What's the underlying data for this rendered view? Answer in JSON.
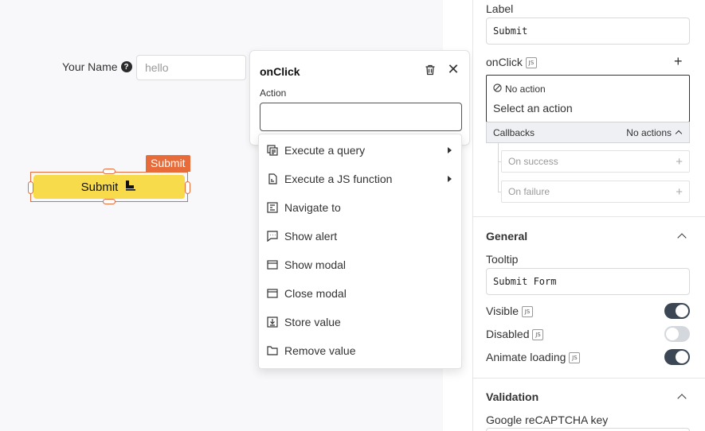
{
  "canvas": {
    "name_label": "Your Name",
    "name_input_value": "hello",
    "submit_tag": "Submit",
    "submit_button": "Submit"
  },
  "popover": {
    "title": "onClick",
    "action_label": "Action",
    "action_value": "",
    "menu": [
      {
        "label": "Execute a query",
        "icon": "query-icon",
        "submenu": true
      },
      {
        "label": "Execute a JS function",
        "icon": "js-function-icon",
        "submenu": true
      },
      {
        "label": "Navigate to",
        "icon": "navigate-icon",
        "submenu": false
      },
      {
        "label": "Show alert",
        "icon": "alert-icon",
        "submenu": false
      },
      {
        "label": "Show modal",
        "icon": "modal-icon",
        "submenu": false
      },
      {
        "label": "Close modal",
        "icon": "close-modal-icon",
        "submenu": false
      },
      {
        "label": "Store value",
        "icon": "store-value-icon",
        "submenu": false
      },
      {
        "label": "Remove value",
        "icon": "folder-icon",
        "submenu": false
      }
    ]
  },
  "panel": {
    "label_title": "Label",
    "label_value": "Submit",
    "onclick_title": "onClick",
    "js_badge": "JS",
    "no_action": "No action",
    "select_action": "Select an action",
    "callbacks": "Callbacks",
    "callbacks_status": "No actions",
    "on_success": "On success",
    "on_failure": "On failure",
    "general_title": "General",
    "tooltip_title": "Tooltip",
    "tooltip_value": "Submit Form",
    "visible_label": "Visible",
    "visible_on": true,
    "disabled_label": "Disabled",
    "disabled_on": false,
    "animate_label": "Animate loading",
    "animate_on": true,
    "validation_title": "Validation",
    "recaptcha_label": "Google reCAPTCHA key"
  },
  "colors": {
    "accent_orange": "#e86b3a",
    "button_yellow": "#f8db4b",
    "toggle_on": "#3b4754",
    "toggle_off": "#d4d8dd"
  }
}
